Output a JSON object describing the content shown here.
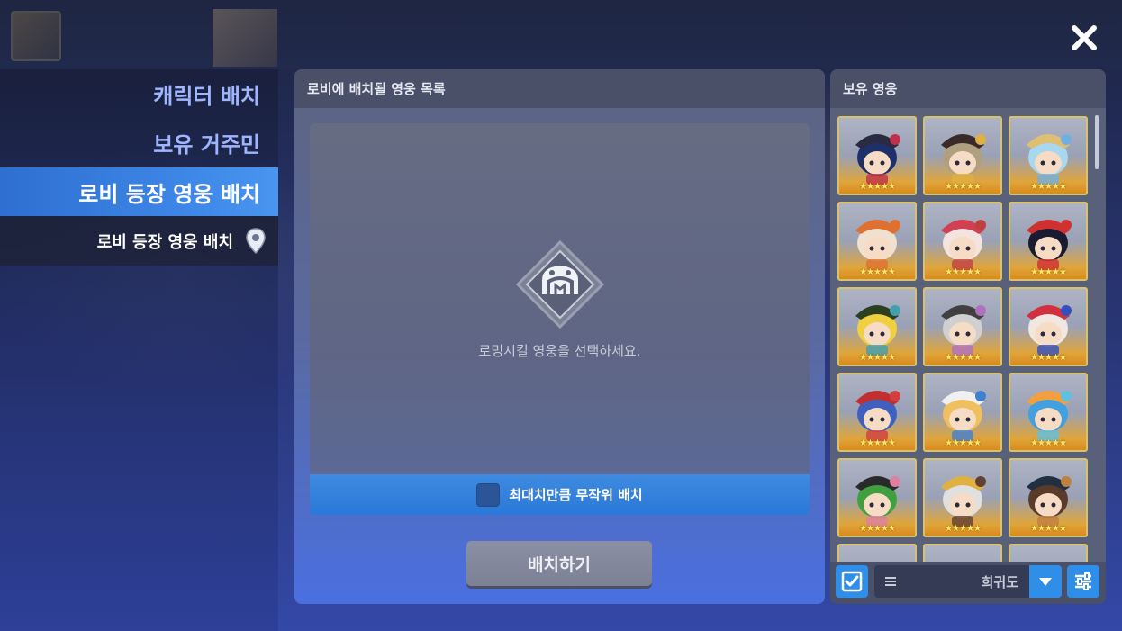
{
  "sidebar": {
    "items": [
      {
        "label": "캐릭터 배치"
      },
      {
        "label": "보유 거주민"
      },
      {
        "label": "로비 등장 영웅 배치"
      }
    ],
    "sub_item": {
      "label": "로비 등장 영웅 배치",
      "icon": "map-pin-icon"
    }
  },
  "close": {
    "icon": "close-icon"
  },
  "center_panel": {
    "title": "로비에 배치될 영웅 목록",
    "empty_message": "로밍시킬 영웅을 선택하세요.",
    "random_option_label": "최대치만큼 무작위 배치",
    "random_option_checked": false,
    "place_button_label": "배치하기"
  },
  "right_panel": {
    "title": "보유 영웅",
    "hero_cards": [
      {
        "stars": "★★★★★",
        "hair": "#1f2f6a",
        "hat": "#2a2a40",
        "accent": "#c0304a"
      },
      {
        "stars": "★★★★★",
        "hair": "#b0a080",
        "hat": "#3a2a2a",
        "accent": "#e0b040"
      },
      {
        "stars": "★★★★★",
        "hair": "#a8d8f0",
        "hat": "#e0c070",
        "accent": "#70b0e0"
      },
      {
        "stars": "★★★★★",
        "hair": "#f0e0d0",
        "hat": "#e07030",
        "accent": "#e07030"
      },
      {
        "stars": "★★★★★",
        "hair": "#f4e4e0",
        "hat": "#d04050",
        "accent": "#c04040"
      },
      {
        "stars": "★★★★★",
        "hair": "#1a1a30",
        "hat": "#d03030",
        "accent": "#d03030"
      },
      {
        "stars": "★★★★★",
        "hair": "#f0d040",
        "hat": "#2a4020",
        "accent": "#40a0b0"
      },
      {
        "stars": "★★★★★",
        "hair": "#d0d0d0",
        "hat": "#404040",
        "accent": "#b070c0"
      },
      {
        "stars": "★★★★★",
        "hair": "#f0e8e0",
        "hat": "#d03040",
        "accent": "#3050c0"
      },
      {
        "stars": "★★★★★",
        "hair": "#4060c0",
        "hat": "#c03030",
        "accent": "#d04040"
      },
      {
        "stars": "★★★★★",
        "hair": "#f0c060",
        "hat": "#f0f0f0",
        "accent": "#4080d0"
      },
      {
        "stars": "★★★★★",
        "hair": "#40a0e0",
        "hat": "#f0a040",
        "accent": "#60c0e0"
      },
      {
        "stars": "★★★★★",
        "hair": "#40a040",
        "hat": "#2a2a2a",
        "accent": "#e080a0"
      },
      {
        "stars": "★★★★★",
        "hair": "#e0e0e0",
        "hat": "#e0b040",
        "accent": "#604030"
      },
      {
        "stars": "★★★★★",
        "hair": "#5a3a2a",
        "hat": "#203040",
        "accent": "#c08040"
      },
      {
        "stars": "",
        "hair": "#3a2a5a",
        "hat": "#3a2a5a",
        "accent": "#3a2a5a"
      },
      {
        "stars": "",
        "hair": "#80c0f0",
        "hat": "#80c0f0",
        "accent": "#80c0f0"
      },
      {
        "stars": "",
        "hair": "#4a3a2a",
        "hat": "#4a3a2a",
        "accent": "#4a3a2a"
      }
    ],
    "sort_label": "희귀도",
    "select_all_checked": true
  }
}
